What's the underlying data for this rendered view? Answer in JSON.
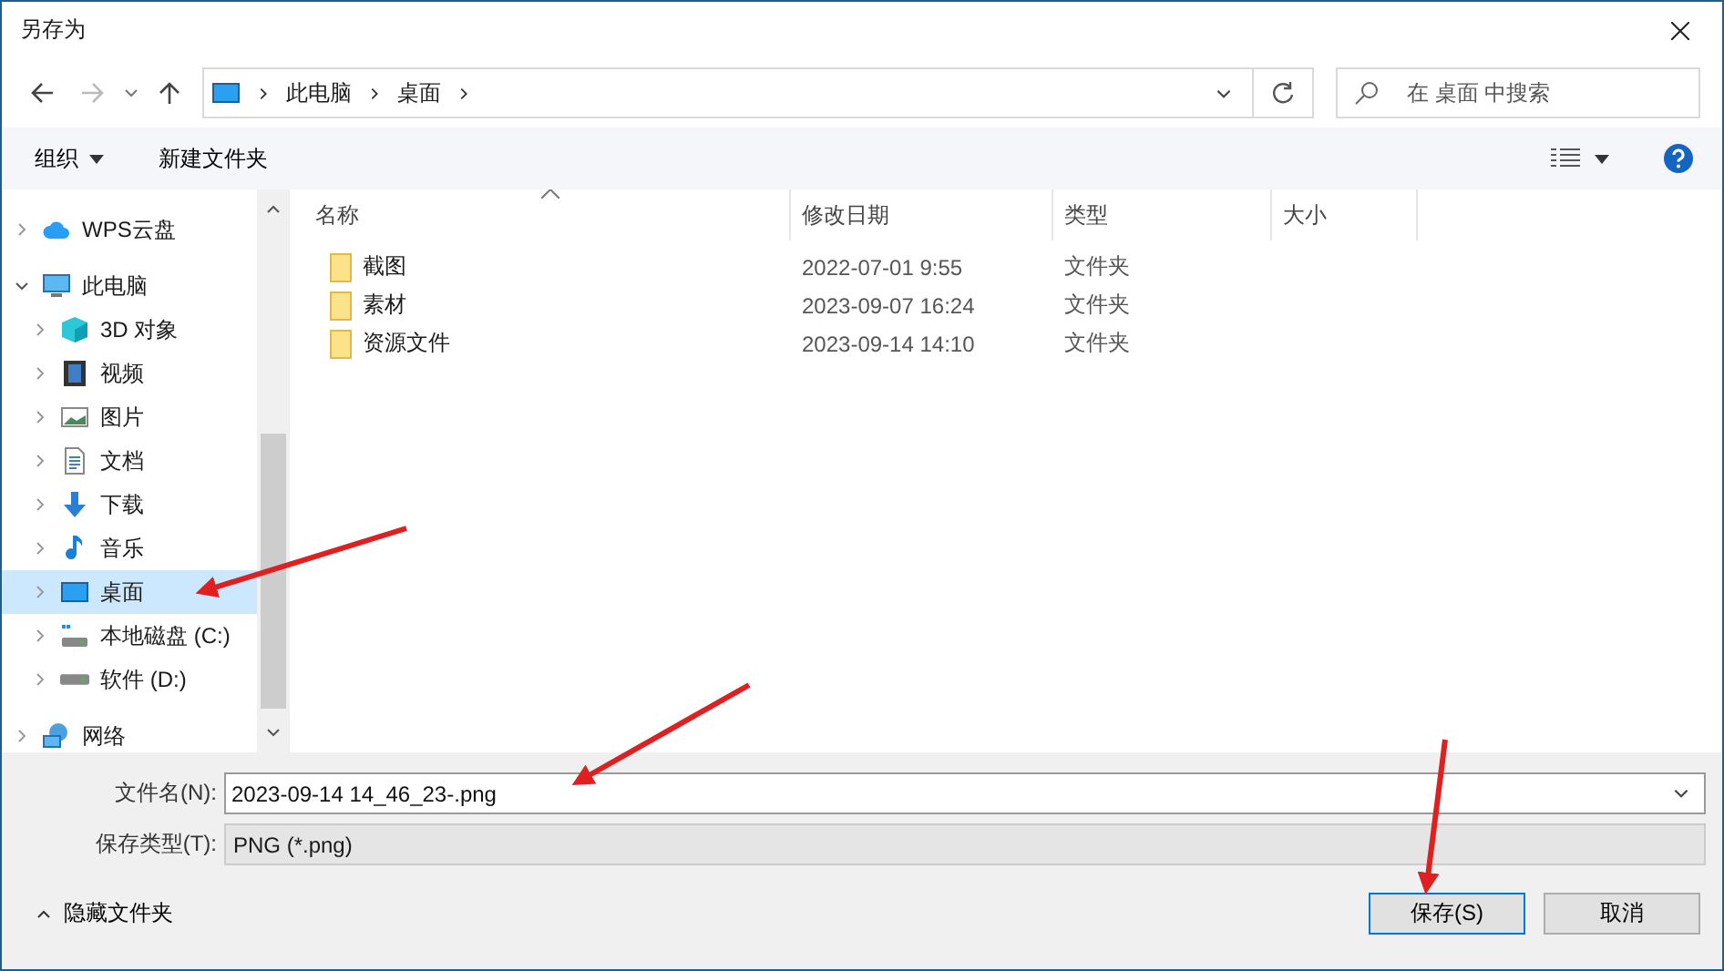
{
  "window": {
    "title": "另存为"
  },
  "address_bar": {
    "path": [
      {
        "label": "此电脑"
      },
      {
        "label": "桌面"
      }
    ]
  },
  "search": {
    "placeholder": "在 桌面 中搜索"
  },
  "toolbar": {
    "organize": "组织",
    "new_folder": "新建文件夹"
  },
  "sidebar": {
    "items": [
      {
        "label": "WPS云盘",
        "kind": "cloud",
        "expanded": false,
        "selected": false
      },
      {
        "label": "此电脑",
        "kind": "pc",
        "expanded": true,
        "selected": false,
        "children": [
          {
            "label": "3D 对象",
            "kind": "cube",
            "expanded": false,
            "selected": false
          },
          {
            "label": "视频",
            "kind": "video",
            "expanded": false,
            "selected": false
          },
          {
            "label": "图片",
            "kind": "picture",
            "expanded": false,
            "selected": false
          },
          {
            "label": "文档",
            "kind": "document",
            "expanded": false,
            "selected": false
          },
          {
            "label": "下载",
            "kind": "download",
            "expanded": false,
            "selected": false
          },
          {
            "label": "音乐",
            "kind": "music",
            "expanded": false,
            "selected": false
          },
          {
            "label": "桌面",
            "kind": "desktop",
            "expanded": false,
            "selected": true
          },
          {
            "label": "本地磁盘 (C:)",
            "kind": "system-drive",
            "expanded": false,
            "selected": false
          },
          {
            "label": "软件 (D:)",
            "kind": "drive",
            "expanded": false,
            "selected": false
          }
        ]
      },
      {
        "label": "网络",
        "kind": "network",
        "expanded": false,
        "selected": false
      }
    ]
  },
  "table": {
    "columns": [
      "名称",
      "修改日期",
      "类型",
      "大小"
    ],
    "rows": [
      {
        "name": "截图",
        "modified": "2022-07-01 9:55",
        "type": "文件夹",
        "size": ""
      },
      {
        "name": "素材",
        "modified": "2023-09-07 16:24",
        "type": "文件夹",
        "size": ""
      },
      {
        "name": "资源文件",
        "modified": "2023-09-14 14:10",
        "type": "文件夹",
        "size": ""
      }
    ]
  },
  "form": {
    "filename_label": "文件名(N):",
    "filename": "2023-09-14 14_46_23-.png",
    "type_label": "保存类型(T):",
    "type": "PNG (*.png)"
  },
  "hide_folders": "隐藏文件夹",
  "buttons": [
    "保存(S)",
    "取消"
  ]
}
